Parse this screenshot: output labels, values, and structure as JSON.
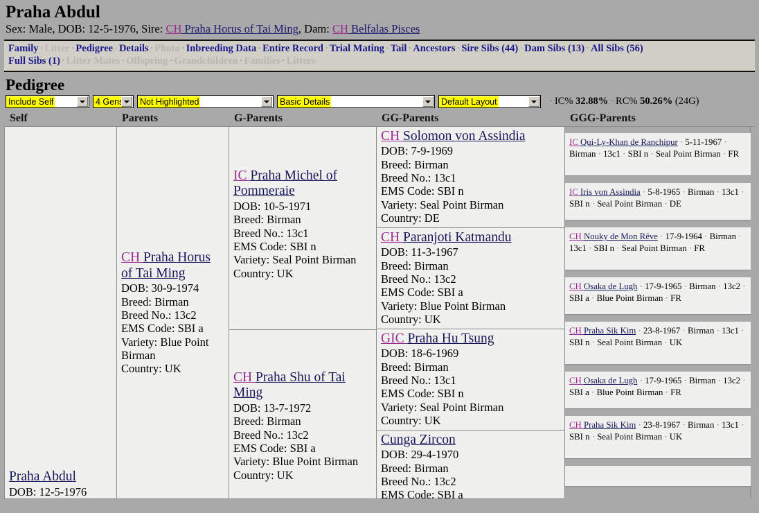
{
  "header": {
    "animal_name": "Praha Abdul",
    "sex_label": "Sex: Male, DOB: 12-5-1976, Sire: ",
    "sire_title": "CH",
    "sire_name": " Praha Horus of Tai Ming",
    "dam_label": ", Dam: ",
    "dam_title": "CH",
    "dam_name": " Belfalas Pisces"
  },
  "nav": {
    "row1": [
      {
        "label": "Family",
        "enabled": true
      },
      {
        "label": "Litter",
        "enabled": false
      },
      {
        "label": "Pedigree",
        "enabled": true
      },
      {
        "label": "Details",
        "enabled": true
      },
      {
        "label": "Photo",
        "enabled": false
      },
      {
        "label": "Inbreeding Data",
        "enabled": true
      },
      {
        "label": "Entire Record",
        "enabled": true
      },
      {
        "label": "Trial Mating",
        "enabled": true
      },
      {
        "label": "Tail",
        "enabled": true
      },
      {
        "label": "Ancestors",
        "enabled": true
      },
      {
        "label": "Sire Sibs (44)",
        "enabled": true
      },
      {
        "label": "Dam Sibs (13)",
        "enabled": true
      },
      {
        "label": "All Sibs (56)",
        "enabled": true
      }
    ],
    "row2": [
      {
        "label": "Full Sibs (1)",
        "enabled": true
      },
      {
        "label": "Litter Mates",
        "enabled": false
      },
      {
        "label": "Offspring",
        "enabled": false
      },
      {
        "label": "Grandchildren",
        "enabled": false
      },
      {
        "label": "Families",
        "enabled": false
      },
      {
        "label": "Litters",
        "enabled": false
      }
    ],
    "separator": "·"
  },
  "pedigree": {
    "heading": "Pedigree",
    "controls": {
      "include": "Include Self",
      "gens": "4 Gens",
      "highlight": "Not Highlighted",
      "detail": "Basic Details",
      "layout": "Default Layout"
    },
    "stats": {
      "sep": "·",
      "ic_label": "IC%",
      "ic_value": "32.88%",
      "rc_label": "RC%",
      "rc_value": "50.26%",
      "generations": "(24G)"
    },
    "columns": [
      "Self",
      "Parents",
      "G-Parents",
      "GG-Parents",
      "GGG-Parents"
    ],
    "self": {
      "title": "",
      "name": "Praha Abdul",
      "details": [
        "DOB: 12-5-1976"
      ]
    },
    "parents": [
      {
        "title": "CH",
        "name": "Praha Horus of Tai Ming",
        "details": [
          "DOB: 30-9-1974",
          "Breed: Birman",
          "Breed No.: 13c2",
          "EMS Code: SBI a",
          "Variety: Blue Point Birman",
          "Country: UK"
        ]
      }
    ],
    "gparents": [
      {
        "title": "IC",
        "name": "Praha Michel of Pommeraie",
        "details": [
          "DOB: 10-5-1971",
          "Breed: Birman",
          "Breed No.: 13c1",
          "EMS Code: SBI n",
          "Variety: Seal Point Birman",
          "Country: UK"
        ]
      },
      {
        "title": "CH",
        "name": "Praha Shu of Tai Ming",
        "details": [
          "DOB: 13-7-1972",
          "Breed: Birman",
          "Breed No.: 13c2",
          "EMS Code: SBI a",
          "Variety: Blue Point Birman",
          "Country: UK"
        ]
      }
    ],
    "ggparents": [
      {
        "title": "CH",
        "name": "Solomon von Assindia",
        "details": [
          "DOB: 7-9-1969",
          "Breed: Birman",
          "Breed No.: 13c1",
          "EMS Code: SBI n",
          "Variety: Seal Point Birman",
          "Country: DE"
        ]
      },
      {
        "title": "CH",
        "name": "Paranjoti Katmandu",
        "details": [
          "DOB: 11-3-1967",
          "Breed: Birman",
          "Breed No.: 13c2",
          "EMS Code: SBI a",
          "Variety: Blue Point Birman",
          "Country: UK"
        ]
      },
      {
        "title": "GIC",
        "name": "Praha Hu Tsung",
        "details": [
          "DOB: 18-6-1969",
          "Breed: Birman",
          "Breed No.: 13c1",
          "EMS Code: SBI n",
          "Variety: Seal Point Birman",
          "Country: UK"
        ]
      },
      {
        "title": "",
        "name": "Cunga Zircon",
        "details": [
          "DOB: 29-4-1970",
          "Breed: Birman",
          "Breed No.: 13c2",
          "EMS Code: SBI a"
        ]
      }
    ],
    "gggparents": [
      {
        "title": "IC",
        "name": "Qui-Ly-Khan de Ranchipur",
        "facts": [
          "5-11-1967",
          "Birman",
          "13c1",
          "SBI n",
          "Seal Point Birman",
          "FR"
        ]
      },
      {
        "title": "IC",
        "name": "Iris von Assindia",
        "facts": [
          "5-8-1965",
          "Birman",
          "13c1",
          "SBI n",
          "Seal Point Birman",
          "DE"
        ]
      },
      {
        "title": "CH",
        "name": "Nouky de Mon Rêve",
        "facts": [
          "17-9-1964",
          "Birman",
          "13c1",
          "SBI n",
          "Seal Point Birman",
          "FR"
        ]
      },
      {
        "title": "CH",
        "name": "Osaka de Lugh",
        "facts": [
          "17-9-1965",
          "Birman",
          "13c2",
          "SBI a",
          "Blue Point Birman",
          "FR"
        ]
      },
      {
        "title": "CH",
        "name": "Praha Sik Kim",
        "facts": [
          "23-8-1967",
          "Birman",
          "13c1",
          "SBI n",
          "Seal Point Birman",
          "UK"
        ]
      },
      {
        "title": "CH",
        "name": "Osaka de Lugh",
        "facts": [
          "17-9-1965",
          "Birman",
          "13c2",
          "SBI a",
          "Blue Point Birman",
          "FR"
        ]
      },
      {
        "title": "CH",
        "name": "Praha Sik Kim",
        "facts": [
          "23-8-1967",
          "Birman",
          "13c1",
          "SBI n",
          "Seal Point Birman",
          "UK"
        ]
      },
      {
        "title": "",
        "name": "",
        "facts": []
      }
    ],
    "fact_sep": "·"
  },
  "colors": {
    "page_bg": "#a9a9a9",
    "cell_bg": "#f0f0ee",
    "nav_bg": "#d2cfc7",
    "link": "#1a1a8c",
    "title_prefix": "#9b2a8e",
    "highlight": "#ffff00"
  }
}
